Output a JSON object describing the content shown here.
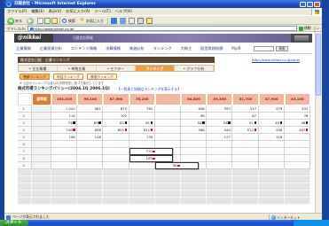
{
  "window": {
    "title": "日経会社 - Microsoft Internet Explorer"
  },
  "menu": {
    "items": [
      "ファイル(F)",
      "編集(E)",
      "表示(V)",
      "お気に入り(A)",
      "ツール(T)",
      "ヘルプ(H)"
    ]
  },
  "toolbar": {
    "back": "戻る",
    "search": "検索",
    "favorites": "お気に入り"
  },
  "address": {
    "label": "アドレス(D)",
    "url": "http://www.nikkei.co.jp/",
    "go": "移動",
    "links": "リンク"
  },
  "site": {
    "logo": "@nikkei",
    "banner": "日経会社情報",
    "nav": [
      "企業情報",
      "企業投資分析",
      "コンテンツ情報",
      "決算情報",
      "株価分析",
      "ランキング",
      "大株主",
      "経営財務指標",
      "MyIR"
    ],
    "search_button": "検索",
    "info_text": "株式会社日経 : 企業ランキング",
    "info_link": "http://www.nikkei.co.jp/rank/",
    "tabs": [
      "• 全企業種",
      "• 単独企業",
      "• セクター",
      "ランキング",
      "• グラフ分析"
    ],
    "buttons": [
      "業績ランキング",
      "利益ランキング",
      "株価ランキング"
    ],
    "note": "※ 上記のランキングは各社の決算短信に基づき集計しています"
  },
  "table": {
    "title": "株式市場ランキングバリュー(2004.1Q 2006.1Q)",
    "link": "【一覧表と詳細なランキングを表示する】",
    "header_color": "#f3b8a2",
    "headers": [
      "",
      "基準値",
      "102,000",
      "98,100",
      "87,500",
      "76,200",
      "",
      "64,800",
      "59,300",
      "51,700",
      "47,900",
      "43,100"
    ],
    "rows": [
      {
        "cells": [
          "1",
          "",
          "1,020",
          "981",
          "875",
          "762",
          "",
          "648",
          "593",
          "517",
          "479",
          "431"
        ]
      },
      {
        "cells": [
          "2",
          "",
          "114",
          "",
          "102",
          "",
          "",
          "98",
          "",
          "87",
          "",
          "76"
        ]
      },
      {
        "cells": [
          "3",
          "",
          "74",
          "69",
          "65",
          "61",
          "",
          "58",
          "54",
          "51",
          "49",
          "46"
        ],
        "marked": [
          2,
          3,
          4,
          5,
          7,
          8,
          9,
          10,
          11
        ],
        "mark_color": "#222222"
      },
      {
        "cells": [
          "4",
          "",
          "740",
          "698",
          "655",
          "612",
          "",
          "588",
          "540",
          "512",
          "498",
          "467"
        ],
        "marked": [
          2,
          4,
          5,
          9,
          11
        ],
        "mark_color": "#c81e1e"
      },
      {
        "cells": [
          "5",
          "",
          "156",
          "148",
          "",
          "139",
          "",
          "",
          "127",
          "",
          "118",
          ""
        ]
      },
      {
        "cells": [
          "6",
          "",
          "",
          "",
          "",
          "",
          "",
          "",
          "",
          "",
          "",
          ""
        ]
      },
      {
        "cells": [
          "7",
          "",
          "",
          "",
          "",
          "770",
          "",
          "",
          "",
          "",
          "",
          ""
        ],
        "marked": [
          5
        ],
        "mark_color": "#c81e1e",
        "boxed": [
          5
        ]
      },
      {
        "cells": [
          "8",
          "",
          "",
          "",
          "",
          "105",
          "",
          "",
          "",
          "",
          "",
          ""
        ],
        "marked": [
          5
        ],
        "mark_color": "#c81e1e",
        "boxed": [
          5
        ]
      },
      {
        "cells": [
          "9",
          "",
          "",
          "",
          "",
          "",
          "98",
          "",
          "",
          "",
          "",
          ""
        ],
        "marked": [
          6
        ],
        "mark_color": "#c81e1e",
        "boxed": [
          6
        ]
      }
    ]
  },
  "status": {
    "text": "ページが表示されました",
    "zone": "インターネット"
  },
  "taskbar": {
    "start": "スタート"
  }
}
